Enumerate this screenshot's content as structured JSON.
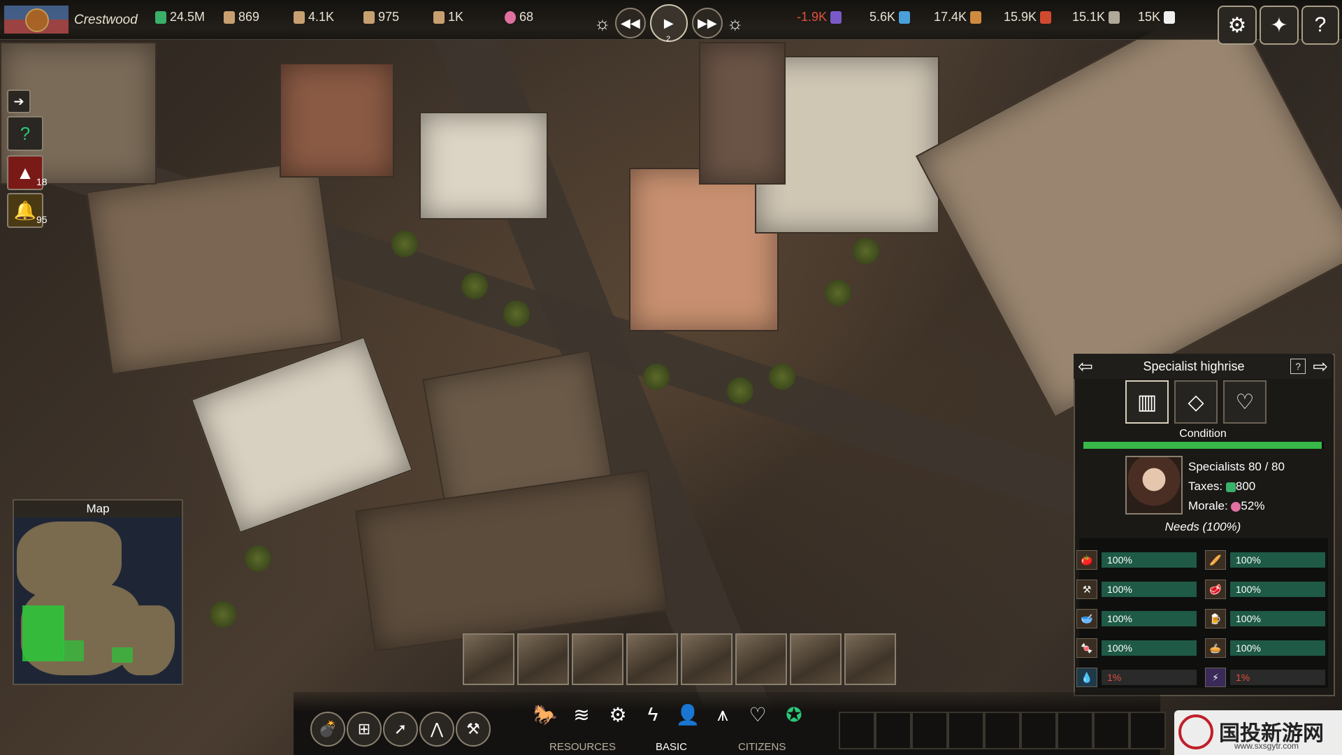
{
  "topbar": {
    "city_name": "Crestwood",
    "stats_left": [
      {
        "value": "24.5M",
        "icon": "money-icon",
        "color": "#3ab06a"
      },
      {
        "value": "869",
        "icon": "worker-icon",
        "color": "#c8a070"
      },
      {
        "value": "4.1K",
        "icon": "farmer-icon",
        "color": "#c8a070"
      },
      {
        "value": "975",
        "icon": "engineer-icon",
        "color": "#c8a070"
      },
      {
        "value": "1K",
        "icon": "specialist-icon",
        "color": "#c8a070"
      },
      {
        "value": "68",
        "icon": "morale-heart-icon",
        "color": "#e070a0"
      }
    ],
    "speed": "2",
    "stats_right": [
      {
        "value": "-1.9K",
        "icon": "energy-icon",
        "negative": true
      },
      {
        "value": "5.6K",
        "icon": "water-icon"
      },
      {
        "value": "17.4K",
        "icon": "bread-icon"
      },
      {
        "value": "15.9K",
        "icon": "meat-icon"
      },
      {
        "value": "15.1K",
        "icon": "goods-icon"
      },
      {
        "value": "15K",
        "icon": "cloth-icon"
      }
    ]
  },
  "left_buttons": [
    {
      "icon": "exit-arrow-icon",
      "count": ""
    },
    {
      "icon": "help-circle-icon",
      "count": ""
    },
    {
      "icon": "warning-icon",
      "count": "18"
    },
    {
      "icon": "bell-icon",
      "count": "95"
    }
  ],
  "map": {
    "title": "Map"
  },
  "panel": {
    "title": "Specialist highrise",
    "condition_label": "Condition",
    "condition_fraction": 0.99,
    "specialists": "Specialists 80 / 80",
    "taxes_label": "Taxes:",
    "taxes_value": "800",
    "morale_label": "Morale:",
    "morale_value": "52%",
    "needs_title": "Needs (100%)",
    "needs": [
      {
        "value": "100%",
        "icon": "food-icon"
      },
      {
        "value": "100%",
        "icon": "bread-icon"
      },
      {
        "value": "100%",
        "icon": "tools-icon"
      },
      {
        "value": "100%",
        "icon": "meat-icon"
      },
      {
        "value": "100%",
        "icon": "soup-icon"
      },
      {
        "value": "100%",
        "icon": "drink-icon"
      },
      {
        "value": "100%",
        "icon": "sweets-icon"
      },
      {
        "value": "100%",
        "icon": "pie-icon"
      },
      {
        "value": "1%",
        "icon": "water-drop-icon",
        "low": true
      },
      {
        "value": "1%",
        "icon": "electricity-icon",
        "low": true
      }
    ]
  },
  "bottom": {
    "labels": {
      "resources": "RESOURCES",
      "basic": "BASIC",
      "citizens": "CITIZENS"
    }
  },
  "watermark": {
    "cn": "国投新游网",
    "url": "www.sxsgytr.com"
  }
}
